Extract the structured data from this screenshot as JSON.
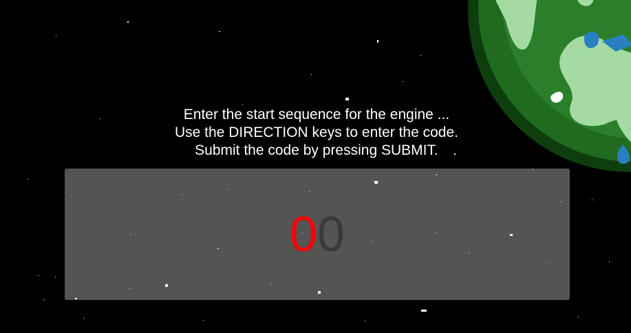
{
  "instructions": {
    "line1": "Enter the start sequence for the engine ...",
    "line2": "Use the DIRECTION keys to enter the code.",
    "line3": "Submit the code by pressing SUBMIT."
  },
  "code": {
    "digits": [
      {
        "value": "0",
        "state": "selected",
        "color": "#ff0000"
      },
      {
        "value": "0",
        "state": "unselected",
        "color": "#3a3a3a"
      }
    ]
  },
  "colors": {
    "background": "#000000",
    "panel": "#5a5a5a",
    "text": "#ffffff",
    "planet_ocean_dark": "#1f6b1f",
    "planet_land_light": "#a3dba3",
    "planet_water": "#2a7fc0"
  }
}
